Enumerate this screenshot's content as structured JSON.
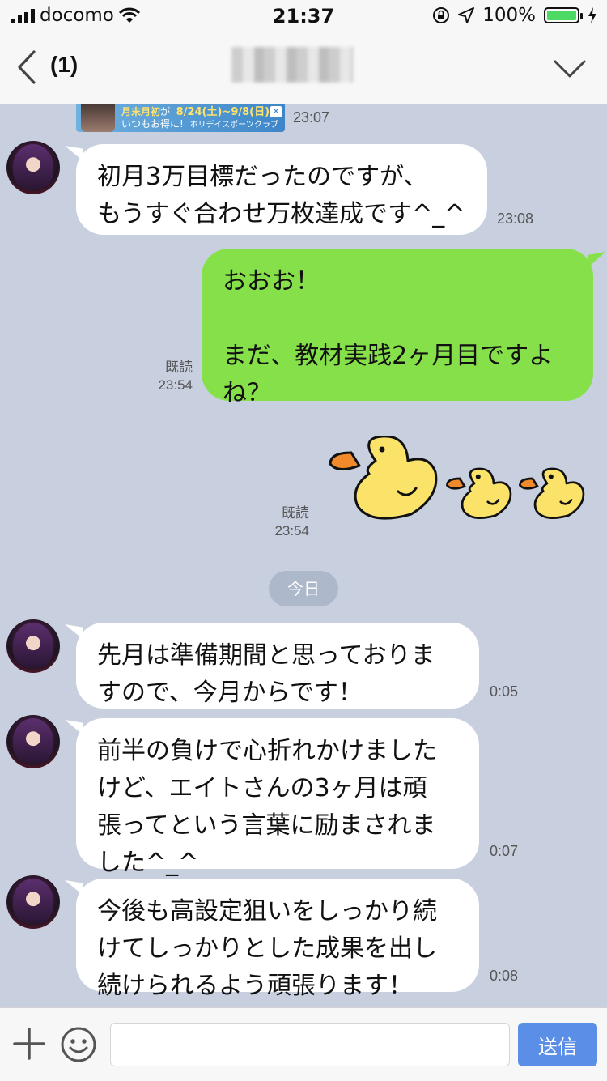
{
  "status_bar": {
    "carrier": "docomo",
    "time": "21:37",
    "battery": "100%",
    "battery_level": 1.0
  },
  "header": {
    "unread_count": "(1)"
  },
  "ad": {
    "line1_a": "月末月初",
    "line1_b": "が",
    "line2": "いつもお得に!",
    "dates": "8/24(土)~9/8(日)",
    "brand": "ホリデイスポーツクラブ"
  },
  "date_divider": "今日",
  "messages": [
    {
      "type": "ad",
      "time": "23:07"
    },
    {
      "dir": "in",
      "text": "初月3万目標だったのですが、\nもうすぐ合わせ万枚達成です^_^",
      "time": "23:08"
    },
    {
      "dir": "out",
      "text": "おおお！\n\nまだ、教材実践2ヶ月目ですよ\nね？",
      "read": "既読",
      "time": "23:54"
    },
    {
      "dir": "out",
      "type": "sticker",
      "sticker": "ducks-sticker",
      "read": "既読",
      "time": "23:54"
    },
    {
      "dir": "in",
      "text": "先月は準備期間と思っておりま\nすので、今月からです！",
      "time": "0:05"
    },
    {
      "dir": "in",
      "text": "前半の負けで心折れかけました\nけど、エイトさんの3ヶ月は頑\n張ってという言葉に励まされま\nした^_^",
      "time": "0:07"
    },
    {
      "dir": "in",
      "text": "今後も高設定狙いをしっかり続\nけてしっかりとした成果を出し\n続けられるよう頑張ります！",
      "time": "0:08"
    }
  ],
  "input_bar": {
    "placeholder": "",
    "send_label": "送信"
  },
  "colors": {
    "chat_background": "#c8d0e0",
    "outgoing_bubble": "#86e04a",
    "incoming_bubble": "#ffffff",
    "send_button": "#5b8ee6"
  },
  "icons": [
    "signal-bars-icon",
    "wifi-icon",
    "rotation-lock-icon",
    "location-arrow-icon",
    "battery-icon",
    "charging-bolt-icon",
    "back-chevron-icon",
    "chevron-down-icon",
    "plus-icon",
    "smiley-icon"
  ]
}
